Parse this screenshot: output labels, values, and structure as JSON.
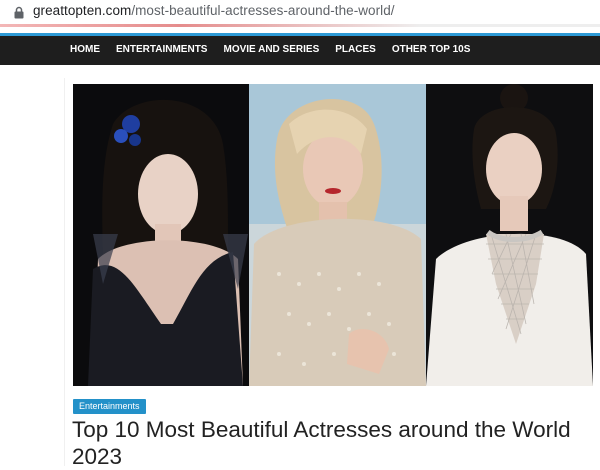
{
  "browser": {
    "url_domain": "greattopten.com",
    "url_path": "/most-beautiful-actresses-around-the-world/"
  },
  "nav": {
    "items": [
      "HOME",
      "ENTERTAINMENTS",
      "MOVIE AND SERIES",
      "PLACES",
      "OTHER TOP 10S"
    ],
    "accent": "#2d9ad6",
    "background": "#1e1e1e"
  },
  "article": {
    "category": "Entertainments",
    "category_color": "#2391c9",
    "title": "Top 10 Most Beautiful Actresses around the World 2023"
  }
}
